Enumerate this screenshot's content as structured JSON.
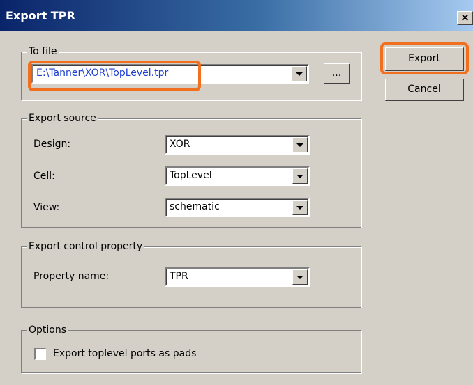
{
  "window": {
    "title": "Export TPR",
    "close_glyph": "×"
  },
  "to_file": {
    "group_label": "To file",
    "path_value": "E:\\Tanner\\XOR\\TopLevel.tpr",
    "browse_label": "..."
  },
  "export_source": {
    "group_label": "Export source",
    "design_label": "Design:",
    "design_value": "XOR",
    "cell_label": "Cell:",
    "cell_value": "TopLevel",
    "view_label": "View:",
    "view_value": "schematic"
  },
  "export_control": {
    "group_label": "Export control property",
    "property_label": "Property name:",
    "property_value": "TPR"
  },
  "options": {
    "group_label": "Options",
    "toplevel_pads_label": "Export toplevel ports as pads",
    "toplevel_pads_checked": false
  },
  "buttons": {
    "export_label": "Export",
    "cancel_label": "Cancel"
  },
  "colors": {
    "highlight": "#f07020",
    "path_text": "#1f3fd0",
    "dialog_bg": "#d4d0c8",
    "titlebar_start": "#0a246a",
    "titlebar_end": "#a6caf0"
  }
}
